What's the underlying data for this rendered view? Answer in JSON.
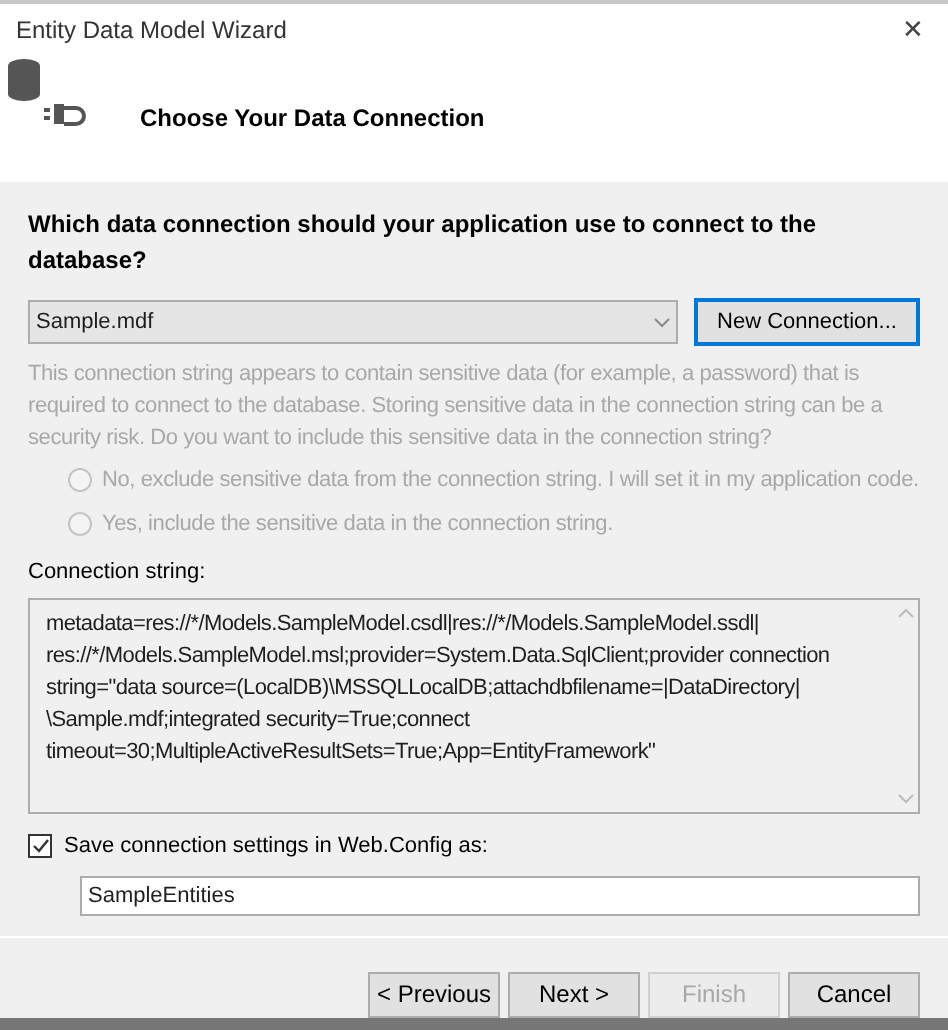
{
  "window": {
    "title": "Entity Data Model Wizard",
    "close": "✕"
  },
  "header": {
    "title": "Choose Your Data Connection"
  },
  "question": "Which data connection should your application use to connect to the database?",
  "connection_dropdown": {
    "value": "Sample.mdf"
  },
  "new_connection_button": {
    "label": "New Connection...",
    "disabled": false
  },
  "sensitive_note": {
    "text": "This connection string appears to contain sensitive data (for example, a password) that is required to connect to the database. Storing sensitive data in the connection string can be a security risk. Do you want to include this sensitive data in the connection string?",
    "disabled": true
  },
  "sensitive_options": [
    {
      "label": "No, exclude sensitive data from the connection string. I will set it in my application code.",
      "selected": false,
      "disabled": true
    },
    {
      "label": "Yes, include the sensitive data in the connection string.",
      "selected": false,
      "disabled": true
    }
  ],
  "connection_string": {
    "label": "Connection string:",
    "lines": [
      "metadata=res://*/Models.SampleModel.csdl|res://*/Models.SampleModel.ssdl|",
      "res://*/Models.SampleModel.msl;provider=System.Data.SqlClient;provider connection",
      "string=\"data source=(LocalDB)\\MSSQLLocalDB;attachdbfilename=|DataDirectory|",
      "\\Sample.mdf;integrated security=True;connect",
      "timeout=30;MultipleActiveResultSets=True;App=EntityFramework\""
    ]
  },
  "save_settings": {
    "label": "Save connection settings in Web.Config as:",
    "checked": true,
    "value": "SampleEntities"
  },
  "buttons": [
    {
      "label": "< Previous",
      "disabled": false
    },
    {
      "label": "Next >",
      "disabled": false
    },
    {
      "label": "Finish",
      "disabled": true
    },
    {
      "label": "Cancel",
      "disabled": false
    }
  ]
}
